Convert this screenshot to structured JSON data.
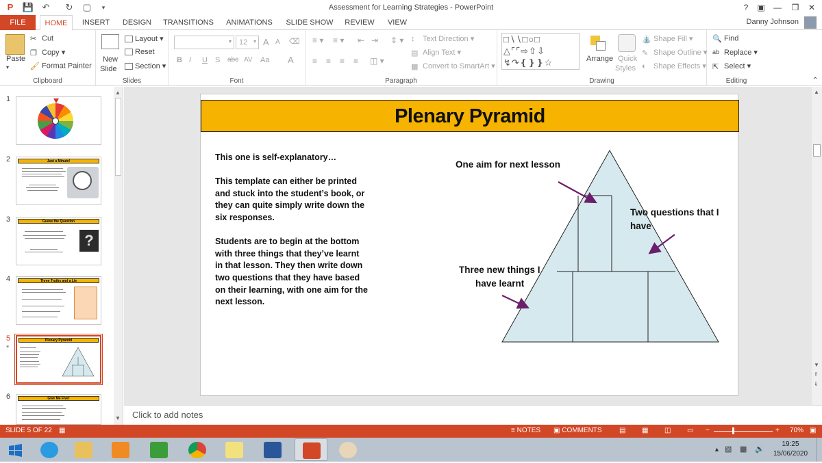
{
  "window": {
    "title": "Assessment for Learning Strategies - PowerPoint",
    "help": "?",
    "user": "Danny Johnson"
  },
  "tabs": [
    "FILE",
    "HOME",
    "INSERT",
    "DESIGN",
    "TRANSITIONS",
    "ANIMATIONS",
    "SLIDE SHOW",
    "REVIEW",
    "VIEW"
  ],
  "ribbon": {
    "clipboard": {
      "label": "Clipboard",
      "paste": "Paste",
      "cut": "Cut",
      "copy": "Copy",
      "format_painter": "Format Painter"
    },
    "slides": {
      "label": "Slides",
      "new_slide_1": "New",
      "new_slide_2": "Slide",
      "layout": "Layout",
      "reset": "Reset",
      "section": "Section"
    },
    "font": {
      "label": "Font",
      "size": "12",
      "bold": "B",
      "italic": "I",
      "underline": "U",
      "shadow": "S",
      "strike": "abc",
      "spacing": "AV",
      "case": "Aa",
      "grow": "A",
      "shrink": "A",
      "color": "A"
    },
    "paragraph": {
      "label": "Paragraph",
      "text_direction": "Text Direction",
      "align_text": "Align Text",
      "convert_smartart": "Convert to SmartArt"
    },
    "drawing": {
      "label": "Drawing",
      "arrange": "Arrange",
      "quick_styles_1": "Quick",
      "quick_styles_2": "Styles",
      "shape_fill": "Shape Fill",
      "shape_outline": "Shape Outline",
      "shape_effects": "Shape Effects"
    },
    "editing": {
      "label": "Editing",
      "find": "Find",
      "replace": "Replace",
      "select": "Select"
    }
  },
  "thumbnails": [
    {
      "num": "1",
      "title": ""
    },
    {
      "num": "2",
      "title": "Just a Minute!"
    },
    {
      "num": "3",
      "title": "Guess the Question"
    },
    {
      "num": "4",
      "title": "Three Truths and a Lie"
    },
    {
      "num": "5",
      "title": "Plenary Pyramid"
    },
    {
      "num": "6",
      "title": "Give Me Five!"
    }
  ],
  "slide": {
    "title": "Plenary Pyramid",
    "p1": "This one is self-explanatory…",
    "p2": "This template can either be printed and stuck into the student’s book, or they can quite simply write down the six responses.",
    "p3": "Students are to begin at the bottom with three things that they’ve learnt in that lesson. They then write down two questions that they have based on their learning, with one aim for the next lesson.",
    "label_aim": "One aim for next lesson",
    "label_questions_1": "Two questions that I",
    "label_questions_2": "have",
    "label_things_1": "Three new things I",
    "label_things_2": "have learnt"
  },
  "notes_placeholder": "Click to add notes",
  "status": {
    "slide_count": "SLIDE 5 OF 22",
    "notes": "NOTES",
    "comments": "COMMENTS",
    "zoom": "70%"
  },
  "clock": {
    "time": "19:25",
    "date": "15/06/2020"
  },
  "colors": {
    "accent": "#d24726",
    "slide_title_bg": "#f6b400",
    "pyramid_fill": "#d6e9ee",
    "arrow": "#6b1f6b"
  }
}
